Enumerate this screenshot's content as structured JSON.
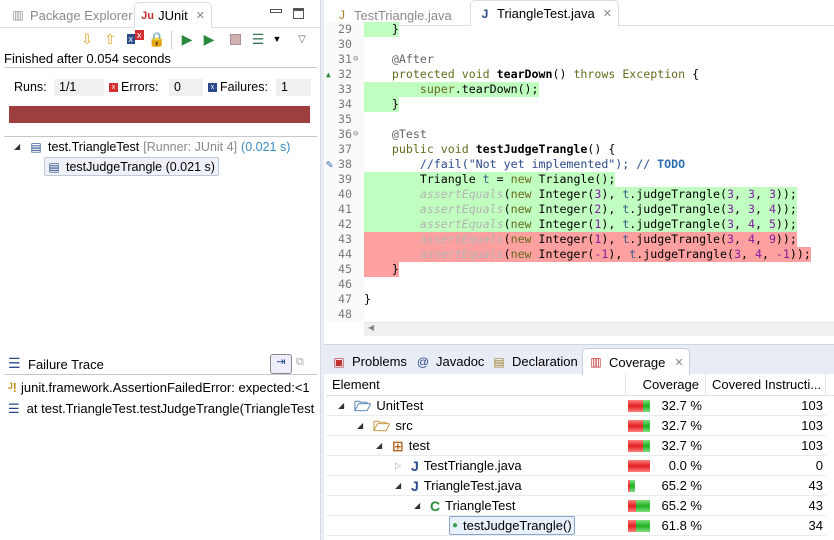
{
  "left": {
    "tabs": [
      {
        "label": "Package Explorer",
        "active": false,
        "icon": "package-explorer-icon"
      },
      {
        "label": "JUnit",
        "active": true,
        "icon": "junit-icon"
      }
    ],
    "toolbar": [
      "next-failure-icon",
      "previous-failure-icon",
      "show-failures-only-icon",
      "scroll-lock-icon",
      "rerun-icon",
      "rerun-failed-first-icon",
      "stop-icon",
      "history-icon",
      "dropdown-icon",
      "view-menu-icon"
    ],
    "status": "Finished after 0.054 seconds",
    "runs_label": "Runs:",
    "runs": "1/1",
    "errors_label": "Errors:",
    "errors": "0",
    "failures_label": "Failures:",
    "failures": "1",
    "progress": {
      "percent": 100,
      "color": "#9e3f3f"
    },
    "tree": [
      {
        "name": "test.TriangleTest",
        "runner": "[Runner: JUnit 4]",
        "time": "(0.021 s)"
      },
      {
        "name": "testJudgeTrangle (0.021 s)"
      }
    ],
    "trace": {
      "title": "Failure Trace",
      "lines": [
        "junit.framework.AssertionFailedError: expected:<1",
        "at test.TriangleTest.testJudgeTrangle(TriangleTest"
      ]
    }
  },
  "editor": {
    "tabs": [
      {
        "label": "TestTriangle.java",
        "active": false
      },
      {
        "label": "TriangleTest.java",
        "active": true
      }
    ],
    "lines": [
      {
        "n": "29",
        "cov": "covered",
        "t": [
          [
            "    }",
            ""
          ]
        ]
      },
      {
        "n": "30",
        "t": []
      },
      {
        "n": "31",
        "fold": true,
        "t": [
          [
            "    ",
            ""
          ],
          [
            "@After",
            "ann"
          ]
        ]
      },
      {
        "n": "32",
        "marker": "override",
        "t": [
          [
            "    ",
            ""
          ],
          [
            "protected",
            "kw"
          ],
          [
            " ",
            ""
          ],
          [
            "void",
            "kw"
          ],
          [
            " ",
            ""
          ],
          [
            "tearDown",
            "m"
          ],
          [
            "() ",
            ""
          ],
          [
            "throws",
            "kw"
          ],
          [
            " ",
            ""
          ],
          [
            "Exception",
            "kw"
          ],
          [
            " {",
            ""
          ]
        ]
      },
      {
        "n": "33",
        "cov": "covered",
        "t": [
          [
            "        ",
            ""
          ],
          [
            "super",
            "kw"
          ],
          [
            ".tearDown();",
            ""
          ]
        ]
      },
      {
        "n": "34",
        "cov": "covered",
        "t": [
          [
            "    }",
            ""
          ]
        ]
      },
      {
        "n": "35",
        "t": []
      },
      {
        "n": "36",
        "fold": true,
        "t": [
          [
            "    ",
            ""
          ],
          [
            "@Test",
            "ann"
          ]
        ]
      },
      {
        "n": "37",
        "t": [
          [
            "    ",
            ""
          ],
          [
            "public",
            "kw"
          ],
          [
            " ",
            ""
          ],
          [
            "void",
            "kw"
          ],
          [
            " ",
            ""
          ],
          [
            "testJudgeTrangle",
            "m"
          ],
          [
            "() {",
            ""
          ]
        ]
      },
      {
        "n": "38",
        "marker": "task",
        "t": [
          [
            "        ",
            ""
          ],
          [
            "//fail(\"Not yet implemented\"); // ",
            "cm"
          ],
          [
            "TODO",
            "todo"
          ]
        ]
      },
      {
        "n": "39",
        "cov": "covered",
        "t": [
          [
            "        Triangle ",
            ""
          ],
          [
            "t",
            "fld"
          ],
          [
            " = ",
            ""
          ],
          [
            "new",
            "kw"
          ],
          [
            " Triangle();",
            ""
          ]
        ]
      },
      {
        "n": "40",
        "cov": "covered",
        "t": [
          [
            "        ",
            ""
          ],
          [
            "assertEquals",
            "st"
          ],
          [
            "(",
            ""
          ],
          [
            "new",
            "kw"
          ],
          [
            " Integer(",
            ""
          ],
          [
            "3",
            "num"
          ],
          [
            "), ",
            ""
          ],
          [
            "t",
            "fld"
          ],
          [
            ".judgeTrangle(",
            ""
          ],
          [
            "3",
            "num"
          ],
          [
            ", ",
            ""
          ],
          [
            "3",
            "num"
          ],
          [
            ", ",
            ""
          ],
          [
            "3",
            "num"
          ],
          [
            "));",
            ""
          ]
        ]
      },
      {
        "n": "41",
        "cov": "covered",
        "t": [
          [
            "        ",
            ""
          ],
          [
            "assertEquals",
            "st"
          ],
          [
            "(",
            ""
          ],
          [
            "new",
            "kw"
          ],
          [
            " Integer(",
            ""
          ],
          [
            "2",
            "num"
          ],
          [
            "), ",
            ""
          ],
          [
            "t",
            "fld"
          ],
          [
            ".judgeTrangle(",
            ""
          ],
          [
            "3",
            "num"
          ],
          [
            ", ",
            ""
          ],
          [
            "3",
            "num"
          ],
          [
            ", ",
            ""
          ],
          [
            "4",
            "num"
          ],
          [
            "));",
            ""
          ]
        ]
      },
      {
        "n": "42",
        "cov": "covered",
        "t": [
          [
            "        ",
            ""
          ],
          [
            "assertEquals",
            "st"
          ],
          [
            "(",
            ""
          ],
          [
            "new",
            "kw"
          ],
          [
            " Integer(",
            ""
          ],
          [
            "1",
            "num"
          ],
          [
            "), ",
            ""
          ],
          [
            "t",
            "fld"
          ],
          [
            ".judgeTrangle(",
            ""
          ],
          [
            "3",
            "num"
          ],
          [
            ", ",
            ""
          ],
          [
            "4",
            "num"
          ],
          [
            ", ",
            ""
          ],
          [
            "5",
            "num"
          ],
          [
            "));",
            ""
          ]
        ]
      },
      {
        "n": "43",
        "cov": "missed",
        "t": [
          [
            "        ",
            ""
          ],
          [
            "assertEquals",
            "st"
          ],
          [
            "(",
            ""
          ],
          [
            "new",
            "kw"
          ],
          [
            " Integer(",
            ""
          ],
          [
            "1",
            "num"
          ],
          [
            "), ",
            ""
          ],
          [
            "t",
            "fld"
          ],
          [
            ".judgeTrangle(",
            ""
          ],
          [
            "3",
            "num"
          ],
          [
            ", ",
            ""
          ],
          [
            "4",
            "num"
          ],
          [
            ", ",
            ""
          ],
          [
            "9",
            "num"
          ],
          [
            "));",
            ""
          ]
        ]
      },
      {
        "n": "44",
        "cov": "missed",
        "t": [
          [
            "        ",
            ""
          ],
          [
            "assertEquals",
            "st"
          ],
          [
            "(",
            ""
          ],
          [
            "new",
            "kw"
          ],
          [
            " Integer(",
            ""
          ],
          [
            "-1",
            "num"
          ],
          [
            "), ",
            ""
          ],
          [
            "t",
            "fld"
          ],
          [
            ".judgeTrangle(",
            ""
          ],
          [
            "3",
            "num"
          ],
          [
            ", ",
            ""
          ],
          [
            "4",
            "num"
          ],
          [
            ", ",
            ""
          ],
          [
            "-1",
            "num"
          ],
          [
            "));",
            ""
          ]
        ]
      },
      {
        "n": "45",
        "cov": "missed",
        "t": [
          [
            "    }",
            ""
          ]
        ]
      },
      {
        "n": "46",
        "t": []
      },
      {
        "n": "47",
        "t": [
          [
            "}",
            ""
          ]
        ]
      },
      {
        "n": "48",
        "t": []
      }
    ],
    "colors": {
      "covered": "#c0ffc0",
      "missed": "#ffa0a0"
    }
  },
  "bottom": {
    "tabs": [
      {
        "label": "Problems",
        "icon": "problems-icon"
      },
      {
        "label": "Javadoc",
        "icon": "at-icon"
      },
      {
        "label": "Declaration",
        "icon": "declaration-icon"
      },
      {
        "label": "Coverage",
        "icon": "coverage-icon",
        "active": true
      }
    ],
    "columns": [
      "Element",
      "Coverage",
      "Covered Instructi..."
    ],
    "rows": [
      {
        "name": "UnitTest",
        "icon": "project-folder-icon",
        "depth": 0,
        "exp": "open",
        "coverage": "32.7 %",
        "pct": 32.7,
        "covered": "103"
      },
      {
        "name": "src",
        "icon": "source-folder-icon",
        "depth": 1,
        "exp": "open",
        "coverage": "32.7 %",
        "pct": 32.7,
        "covered": "103"
      },
      {
        "name": "test",
        "icon": "package-icon",
        "depth": 2,
        "exp": "open",
        "coverage": "32.7 %",
        "pct": 32.7,
        "covered": "103"
      },
      {
        "name": "TestTriangle.java",
        "icon": "java-file-icon",
        "depth": 3,
        "exp": "closed",
        "coverage": "0.0 %",
        "pct": 0,
        "covered": "0"
      },
      {
        "name": "TriangleTest.java",
        "icon": "java-file-icon",
        "depth": 3,
        "exp": "open",
        "coverage": "65.2 %",
        "pct": 65.2,
        "covered": "43"
      },
      {
        "name": "TriangleTest",
        "icon": "class-icon",
        "depth": 4,
        "exp": "open",
        "coverage": "65.2 %",
        "pct": 65.2,
        "covered": "43"
      },
      {
        "name": "testJudgeTrangle()",
        "icon": "method-icon",
        "depth": 5,
        "exp": "",
        "coverage": "61.8 %",
        "pct": 61.8,
        "covered": "34",
        "selected": true
      }
    ]
  }
}
